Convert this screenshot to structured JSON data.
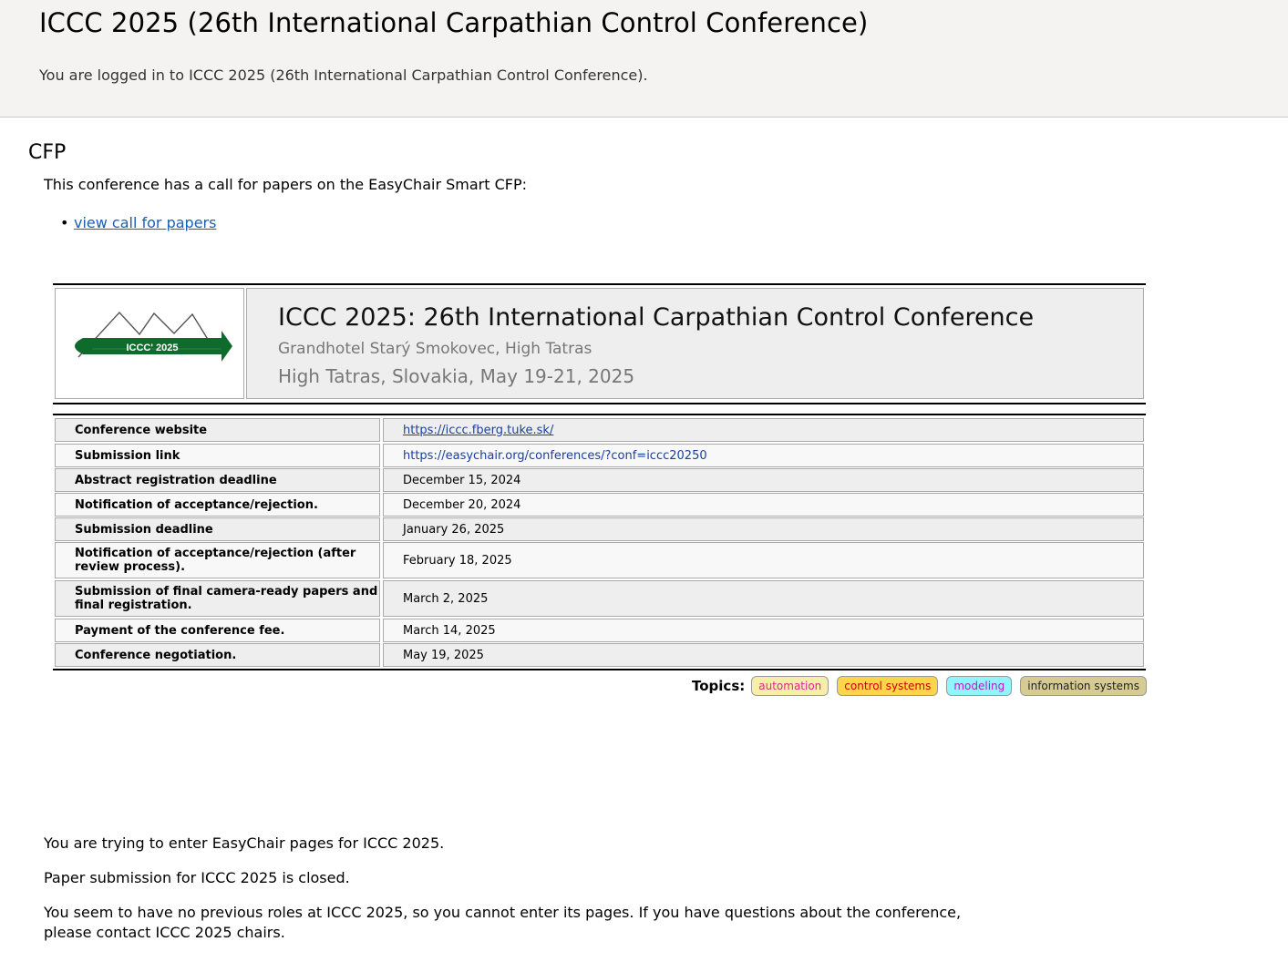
{
  "header": {
    "title": "ICCC 2025 (26th International Carpathian Control Conference)",
    "login_text": "You are logged in to ICCC 2025 (26th International Carpathian Control Conference)."
  },
  "cfp": {
    "title": "CFP",
    "intro": "This conference has a call for papers on the EasyChair Smart CFP:",
    "link_label": "view call for papers"
  },
  "banner": {
    "logo_text": "ICCC' 2025",
    "title": "ICCC 2025: 26th International Carpathian Control Conference",
    "venue": "Grandhotel Starý Smokovec, High Tatras",
    "location_date": "High Tatras, Slovakia, May 19-21, 2025"
  },
  "details": [
    {
      "label": "Conference website",
      "value": "https://iccc.fberg.tuke.sk/"
    },
    {
      "label": "Submission link",
      "value": "https://easychair.org/conferences/?conf=iccc20250"
    },
    {
      "label": "Abstract registration deadline",
      "value": "December 15, 2024"
    },
    {
      "label": "Notification of acceptance/rejection.",
      "value": "December 20, 2024"
    },
    {
      "label": "Submission deadline",
      "value": "January 26, 2025"
    },
    {
      "label": "Notification of acceptance/rejection (after review process).",
      "value": "February 18, 2025"
    },
    {
      "label": "Submission of final camera-ready papers and final registration.",
      "value": "March 2, 2025"
    },
    {
      "label": "Payment of the conference fee.",
      "value": "March 14, 2025"
    },
    {
      "label": "Conference negotiation.",
      "value": "May 19, 2025"
    }
  ],
  "topics": {
    "label": "Topics:",
    "tags": [
      {
        "name": "automation",
        "bg": "#f6eeaa",
        "fg": "#e2258a"
      },
      {
        "name": "control systems",
        "bg": "#ffd54a",
        "fg": "#d10000"
      },
      {
        "name": "modeling",
        "bg": "#8ff5ff",
        "fg": "#b01fc9"
      },
      {
        "name": "information systems",
        "bg": "#d6cc93",
        "fg": "#222222"
      }
    ]
  },
  "messages": [
    "You are trying to enter EasyChair pages for ICCC 2025.",
    "Paper submission for ICCC 2025 is closed.",
    "You seem to have no previous roles at ICCC 2025, so you cannot enter its pages. If you have questions about the conference, please contact ICCC 2025 chairs."
  ]
}
